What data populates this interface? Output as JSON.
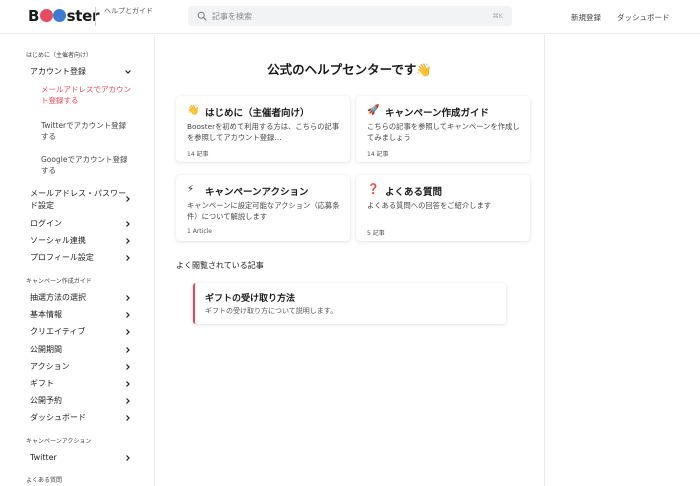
{
  "header": {
    "logo_text": {
      "b": "B",
      "ster": "ster"
    },
    "subtitle": "ヘルプとガイド",
    "search_placeholder": "記事を検索",
    "search_shortcut": "⌘K",
    "nav": {
      "register": "新規登録",
      "dashboard": "ダッシュボード"
    }
  },
  "sidebar": {
    "sections": [
      {
        "title": "はじめに（主催者向け）"
      },
      {
        "title": "キャンペーン作成ガイド"
      },
      {
        "title": "キャンペーンアクション"
      },
      {
        "title": "よくある質問"
      }
    ],
    "account_group": {
      "label": "アカウント登録",
      "children": [
        {
          "label": "メールアドレスでアカウント登録する",
          "active": true
        },
        {
          "label": "Twitterでアカウント登録する",
          "active": false
        },
        {
          "label": "Googleでアカウント登録する",
          "active": false
        }
      ]
    },
    "intro_items": [
      {
        "label": "メールアドレス・パスワード設定"
      },
      {
        "label": "ログイン"
      },
      {
        "label": "ソーシャル連携"
      },
      {
        "label": "プロフィール設定"
      }
    ],
    "guide_items": [
      {
        "label": "抽選方法の選択"
      },
      {
        "label": "基本情報"
      },
      {
        "label": "クリエイティブ"
      },
      {
        "label": "公開期間"
      },
      {
        "label": "アクション"
      },
      {
        "label": "ギフト"
      },
      {
        "label": "公開予約"
      },
      {
        "label": "ダッシュボード"
      }
    ],
    "action_items": [
      {
        "label": "Twitter"
      }
    ]
  },
  "main": {
    "title": "公式のヘルプセンターです👋",
    "cards": [
      {
        "emoji": "👋",
        "title": "はじめに（主催者向け）",
        "description": "Boosterを初めて利用する方は、こちらの記事を参照してアカウント登録…",
        "count": "14 記事"
      },
      {
        "emoji": "🚀",
        "title": "キャンペーン作成ガイド",
        "description": "こちらの記事を参照してキャンペーンを作成してみましょう",
        "count": "14 記事"
      },
      {
        "emoji": "⚡",
        "title": "キャンペーンアクション",
        "description": "キャンペーンに設定可能なアクション（応募条件）について解説します",
        "count": "1 Article"
      },
      {
        "emoji": "❓",
        "title": "よくある質問",
        "description": "よくある質問への回答をご紹介します",
        "count": "5 記事"
      }
    ],
    "popular_heading": "よく閲覧されている記事",
    "popular_articles": [
      {
        "title": "ギフトの受け取り方法",
        "description": "ギフトの受け取り方について説明します。"
      }
    ]
  },
  "colors": {
    "accent": "#e8455d",
    "logo_blue": "#3a7bd5"
  },
  "icons": {
    "search": "search-icon",
    "chevron": "chevron-icon"
  }
}
